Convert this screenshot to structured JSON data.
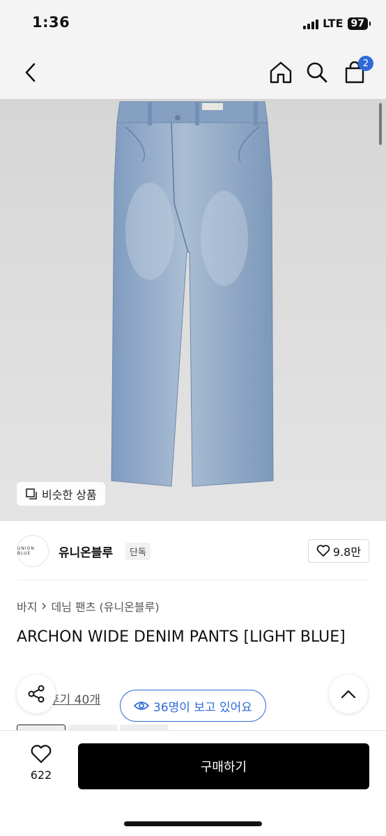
{
  "status_bar": {
    "time": "1:36",
    "network": "LTE",
    "battery": "97"
  },
  "nav": {
    "back_icon": "chevron-left-icon",
    "home_icon": "home-icon",
    "search_icon": "search-icon",
    "cart_icon": "shopping-bag-icon",
    "cart_badge": "2"
  },
  "image": {
    "similar_label": "비슷한 상품",
    "similar_icon": "similar-items-icon"
  },
  "brand": {
    "logo_text": "UNION BLUE",
    "name": "유니온블루",
    "tag": "단독",
    "likes": "9.8만"
  },
  "breadcrumb": {
    "category": "바지",
    "subcategory": "데님 팬츠 (유니온블루)"
  },
  "product": {
    "title": "ARCHON WIDE DENIM PANTS [LIGHT BLUE]"
  },
  "reviews": {
    "label": "후기 40개"
  },
  "viewers": {
    "label": "36명이 보고 있어요"
  },
  "bottom": {
    "wish_count": "622",
    "buy_label": "구매하기"
  },
  "colors": {
    "accent": "#2f6bd8",
    "buy_button": "#000000",
    "denim": "#8fa9c8"
  }
}
